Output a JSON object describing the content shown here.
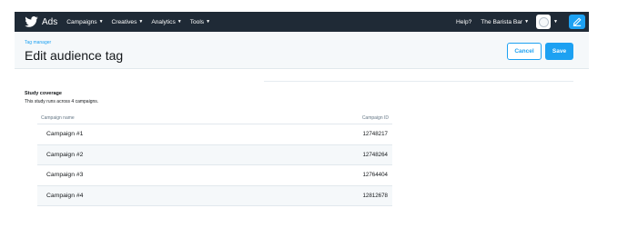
{
  "topbar": {
    "brand": "Ads",
    "nav": [
      {
        "label": "Campaigns"
      },
      {
        "label": "Creatives"
      },
      {
        "label": "Analytics"
      },
      {
        "label": "Tools"
      }
    ],
    "help": "Help?",
    "account": "The Barista Bar",
    "colors": {
      "background": "#1f2a36",
      "accent": "#1da1f2"
    }
  },
  "header": {
    "breadcrumb": "Tag manager",
    "title": "Edit audience tag",
    "cancel_label": "Cancel",
    "save_label": "Save"
  },
  "study": {
    "title": "Study coverage",
    "description": "This study runs across 4 campaigns.",
    "columns": {
      "name": "Campaign name",
      "id": "Campaign ID"
    },
    "rows": [
      {
        "name": "Campaign #1",
        "id": "12748217"
      },
      {
        "name": "Campaign #2",
        "id": "12748264"
      },
      {
        "name": "Campaign #3",
        "id": "12764404"
      },
      {
        "name": "Campaign #4",
        "id": "12812678"
      }
    ]
  },
  "icons": {
    "brand": "twitter-bird-icon",
    "avatar": "account-avatar-icon",
    "compose": "compose-icon",
    "caret": "chevron-down-icon"
  }
}
